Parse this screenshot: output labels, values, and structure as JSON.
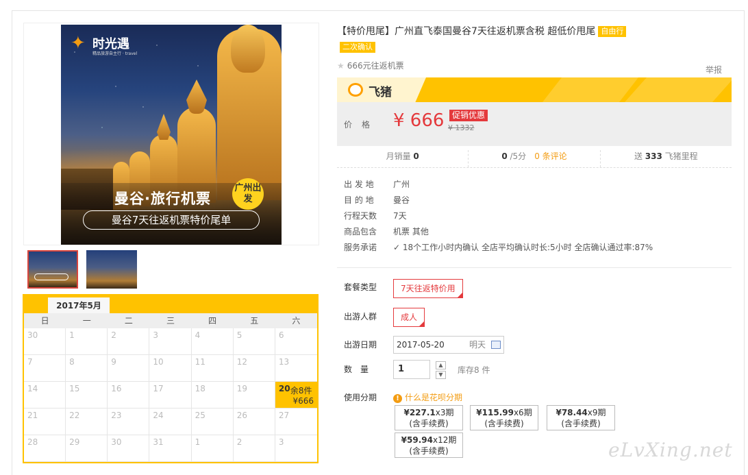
{
  "product": {
    "title": "【特价甩尾】广州直飞泰国曼谷7天往返机票含税 超低价甩尾",
    "tag_free": "自由行",
    "tag_confirm": "二次确认",
    "subtitle": "666元往返机票",
    "report": "举报"
  },
  "image": {
    "logo": "时光遇",
    "logo_sub": "精品旅游自主行 · travel",
    "title1": "曼谷·旅行机票",
    "badge": "广州出发",
    "title2": "曼谷7天往返机票特价尾单"
  },
  "brand": {
    "name": "飞猪"
  },
  "price": {
    "label": "价格",
    "current": "¥ 666",
    "promo": "促销优惠",
    "original": "¥ 1332"
  },
  "stats": {
    "monthly_label": "月销量",
    "monthly": "0",
    "rating": "0",
    "rating_suffix": "/5分",
    "comments": "0 条评论",
    "miles_prefix": "送",
    "miles": "333",
    "miles_suffix": "飞猪里程"
  },
  "info": [
    {
      "k": "出 发 地",
      "v": "广州"
    },
    {
      "k": "目 的 地",
      "v": "曼谷"
    },
    {
      "k": "行程天数",
      "v": "7天"
    },
    {
      "k": "商品包含",
      "v": "机票  其他"
    },
    {
      "k": "服务承诺",
      "v": "✓ 18个工作小时内确认    全店平均确认时长:5小时    全店确认通过率:87%"
    }
  ],
  "options": {
    "package_label": "套餐类型",
    "package_value": "7天往返特价用",
    "people_label": "出游人群",
    "people_value": "成人",
    "date_label": "出游日期",
    "date_value": "2017-05-20",
    "date_hint": "明天",
    "qty_label": "数　量",
    "qty_value": "1",
    "stock": "库存8 件",
    "installment_label": "使用分期",
    "huabei": "什么是花呗分期",
    "installments": [
      {
        "amount": "¥227.1",
        "periods": "x3期",
        "fee": "(含手续费)"
      },
      {
        "amount": "¥115.99",
        "periods": "x6期",
        "fee": "(含手续费)"
      },
      {
        "amount": "¥78.44",
        "periods": "x9期",
        "fee": "(含手续费)"
      },
      {
        "amount": "¥59.94",
        "periods": "x12期",
        "fee": "(含手续费)"
      }
    ]
  },
  "calendar": {
    "month": "2017年5月",
    "weekdays": [
      "日",
      "一",
      "二",
      "三",
      "四",
      "五",
      "六"
    ],
    "days": [
      "30",
      "1",
      "2",
      "3",
      "4",
      "5",
      "6",
      "7",
      "8",
      "9",
      "10",
      "11",
      "12",
      "13",
      "14",
      "15",
      "16",
      "17",
      "18",
      "19",
      "20",
      "21",
      "22",
      "23",
      "24",
      "25",
      "26",
      "27",
      "28",
      "29",
      "30",
      "31",
      "1",
      "2",
      "3"
    ],
    "active_day": "20",
    "active_stock": "余8件",
    "active_price": "¥666"
  },
  "watermark": "eLvXing.net"
}
